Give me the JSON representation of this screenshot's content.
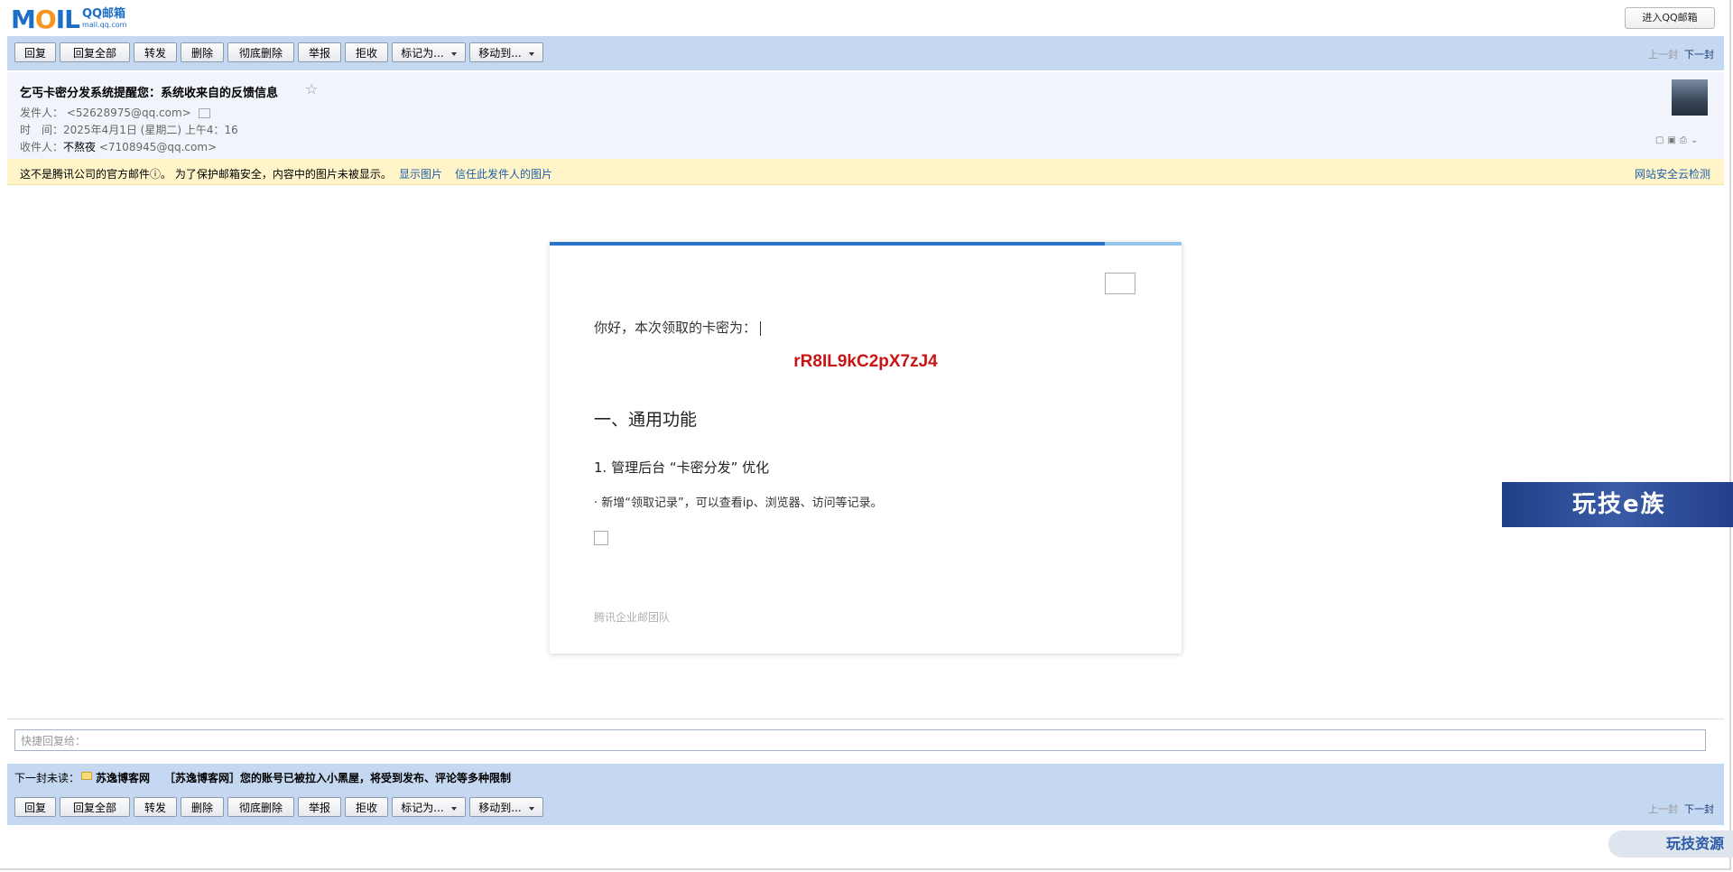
{
  "logo": {
    "mark": "MOIL",
    "m": "M",
    "o": "O",
    "il": "IL",
    "title": "QQ邮箱",
    "domain": "mail.qq.com"
  },
  "header": {
    "enter_button": "进入QQ邮箱"
  },
  "toolbar": {
    "reply": "回复",
    "reply_all": "回复全部",
    "forward": "转发",
    "delete": "删除",
    "delete_forever": "彻底删除",
    "report": "举报",
    "reject": "拒收",
    "mark_as": "标记为...",
    "move_to": "移动到...",
    "prev": "上一封",
    "next": "下一封"
  },
  "mail": {
    "subject": "乞丐卡密分发系统提醒您：系统收来自的反馈信息",
    "sender_label": "发件人：",
    "sender_addr": "<52628975@qq.com>",
    "time_label": "时　间：",
    "time_value": "2025年4月1日 (星期二) 上午4：16",
    "to_label": "收件人：",
    "to_name": "不熬夜",
    "to_addr": "<7108945@qq.com>"
  },
  "warning": {
    "text": "这不是腾讯公司的官方邮件ⓘ。 为了保护邮箱安全，内容中的图片未被显示。",
    "show_images": "显示图片",
    "trust_sender": "信任此发件人的图片",
    "site_check": "网站安全云检测"
  },
  "body": {
    "greeting": "你好，本次领取的卡密为：",
    "code": "rR8IL9kC2pX7zJ4",
    "heading": "一、通用功能",
    "subheading": "1. 管理后台 “卡密分发” 优化",
    "bullet": "· 新增“领取记录”，可以查看ip、浏览器、访问等记录。",
    "team": "腾讯企业邮团队"
  },
  "quick_reply": {
    "placeholder": "快捷回复给："
  },
  "next_unread": {
    "label": "下一封未读：",
    "from": "苏逸博客网",
    "subject": "［苏逸博客网］您的账号已被拉入小黑屋，将受到发布、评论等多种限制"
  },
  "overlays": {
    "ad_banner": "玩技e族",
    "ad_badge": "玩技资源"
  }
}
